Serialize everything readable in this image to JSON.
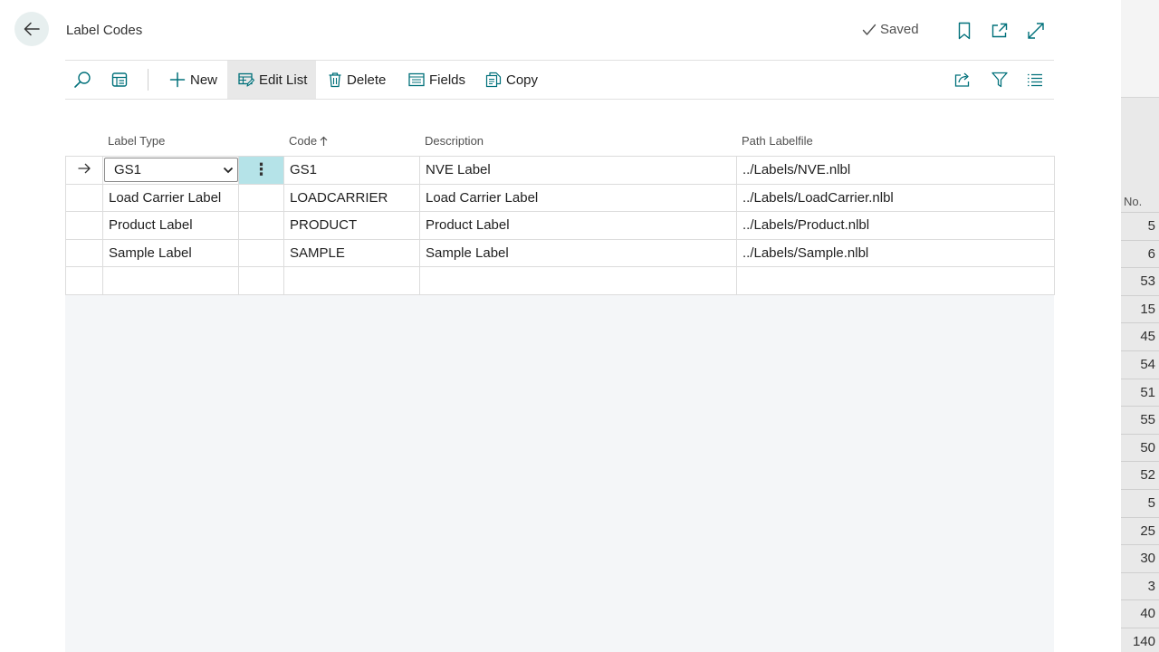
{
  "header": {
    "title": "Label Codes",
    "saved_label": "Saved"
  },
  "actionbar": {
    "new_label": "New",
    "edit_list_label": "Edit List",
    "delete_label": "Delete",
    "fields_label": "Fields",
    "copy_label": "Copy"
  },
  "table": {
    "columns": {
      "label_type": "Label Type",
      "code": "Code",
      "description": "Description",
      "path": "Path Labelfile"
    },
    "rows": [
      {
        "label_type": "GS1",
        "code": "GS1",
        "description": "NVE Label",
        "path": "../Labels/NVE.nlbl"
      },
      {
        "label_type": "Load Carrier Label",
        "code": "LOADCARRIER",
        "description": "Load Carrier Label",
        "path": "../Labels/LoadCarrier.nlbl"
      },
      {
        "label_type": "Product Label",
        "code": "PRODUCT",
        "description": "Product Label",
        "path": "../Labels/Product.nlbl"
      },
      {
        "label_type": "Sample Label",
        "code": "SAMPLE",
        "description": "Sample Label",
        "path": "../Labels/Sample.nlbl"
      }
    ]
  },
  "background_page": {
    "column_header": "No.",
    "values": [
      "5",
      "6",
      "53",
      "15",
      "45",
      "54",
      "51",
      "55",
      "50",
      "52",
      "5",
      "25",
      "30",
      "3",
      "40",
      "140"
    ]
  },
  "colors": {
    "accent": "#00707a",
    "selected_cell": "#b5e3e8",
    "back_button_bg": "#e7efef"
  }
}
